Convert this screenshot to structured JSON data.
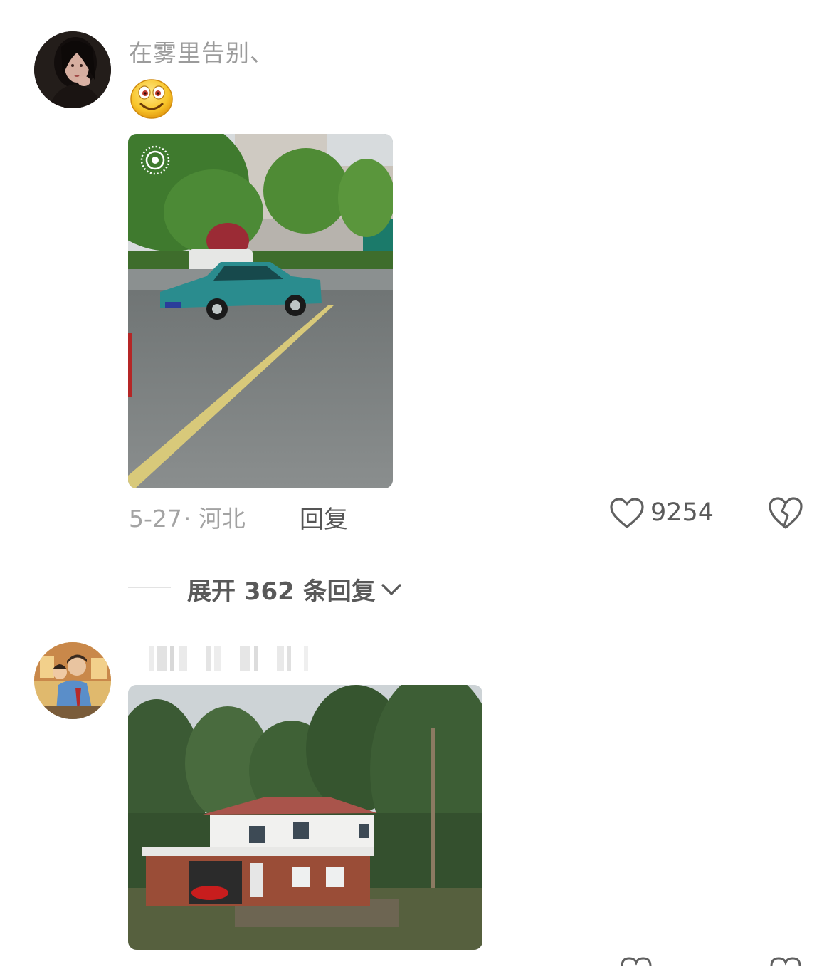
{
  "comments": [
    {
      "username": "在雾里告别、",
      "emoji": "smile-emoji",
      "date": "5-27",
      "location": "· 河北",
      "reply_label": "回复",
      "likes": "9254",
      "expand_label": "展开 362 条回复"
    },
    {
      "username_blurred": true
    }
  ],
  "icons": {
    "like": "heart-outline-icon",
    "dislike": "broken-heart-icon",
    "live": "live-photo-icon",
    "expand": "chevron-down-icon"
  },
  "colors": {
    "text_secondary": "#a3a3a3",
    "text_primary": "#555555",
    "background": "#ffffff"
  }
}
